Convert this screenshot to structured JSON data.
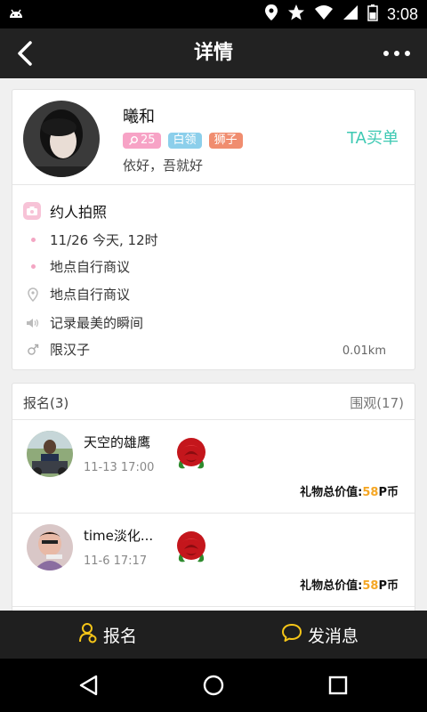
{
  "status_bar": {
    "time": "3:08"
  },
  "app_bar": {
    "title": "详情"
  },
  "profile": {
    "name": "曦和",
    "age": "25",
    "job": "白领",
    "zodiac": "狮子",
    "signature": "依好，吾就好",
    "ta_pay": "TA买单"
  },
  "activity": {
    "title": "约人拍照",
    "time": "11/26 今天, 12时",
    "place_note": "地点自行商议",
    "location": "地点自行商议",
    "description": "记录最美的瞬间",
    "gender_limit": "限汉子",
    "distance": "0.01km"
  },
  "signups": {
    "label": "报名(3)",
    "watch": "围观(17)",
    "entries": [
      {
        "name": "天空的雄鹰",
        "date": "11-13 17:00",
        "gift_prefix": "礼物总价值:",
        "gift_value": "58",
        "gift_unit": "P币"
      },
      {
        "name": "time淡化...",
        "date": "11-6 17:17",
        "gift_prefix": "礼物总价值:",
        "gift_value": "58",
        "gift_unit": "P币"
      }
    ]
  },
  "bottom_bar": {
    "signup": "报名",
    "message": "发消息"
  },
  "colors": {
    "accent": "#3ec9b3",
    "gift": "#f5a623",
    "icon_yellow": "#f5c518"
  }
}
